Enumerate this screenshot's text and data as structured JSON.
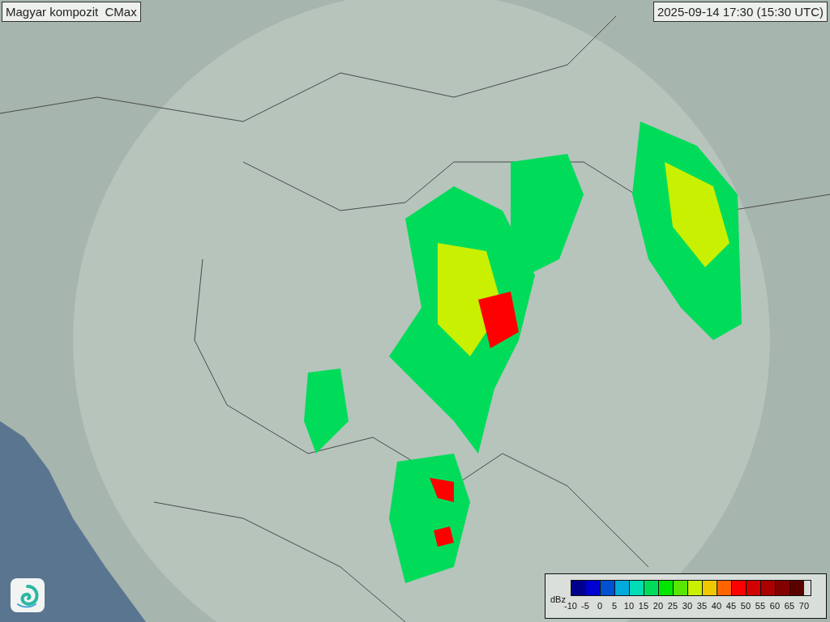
{
  "title": "Magyar kompozit  CMax",
  "timestamp": "2025-09-14 17:30 (15:30 UTC)",
  "legend": {
    "unit": "dBz",
    "swatches": [
      {
        "color": "#00008c"
      },
      {
        "color": "#0000d2"
      },
      {
        "color": "#0050d2"
      },
      {
        "color": "#00aadc"
      },
      {
        "color": "#00dcb4"
      },
      {
        "color": "#00dc5a"
      },
      {
        "color": "#00e600"
      },
      {
        "color": "#5ae600"
      },
      {
        "color": "#c8f000"
      },
      {
        "color": "#f0c800"
      },
      {
        "color": "#ff6400"
      },
      {
        "color": "#ff0000"
      },
      {
        "color": "#d20000"
      },
      {
        "color": "#aa0000"
      },
      {
        "color": "#820000"
      },
      {
        "color": "#5a0000"
      }
    ],
    "ticks": [
      "-10",
      "-5",
      "0",
      "5",
      "10",
      "15",
      "20",
      "25",
      "30",
      "35",
      "40",
      "45",
      "50",
      "55",
      "60",
      "65",
      "70"
    ]
  }
}
